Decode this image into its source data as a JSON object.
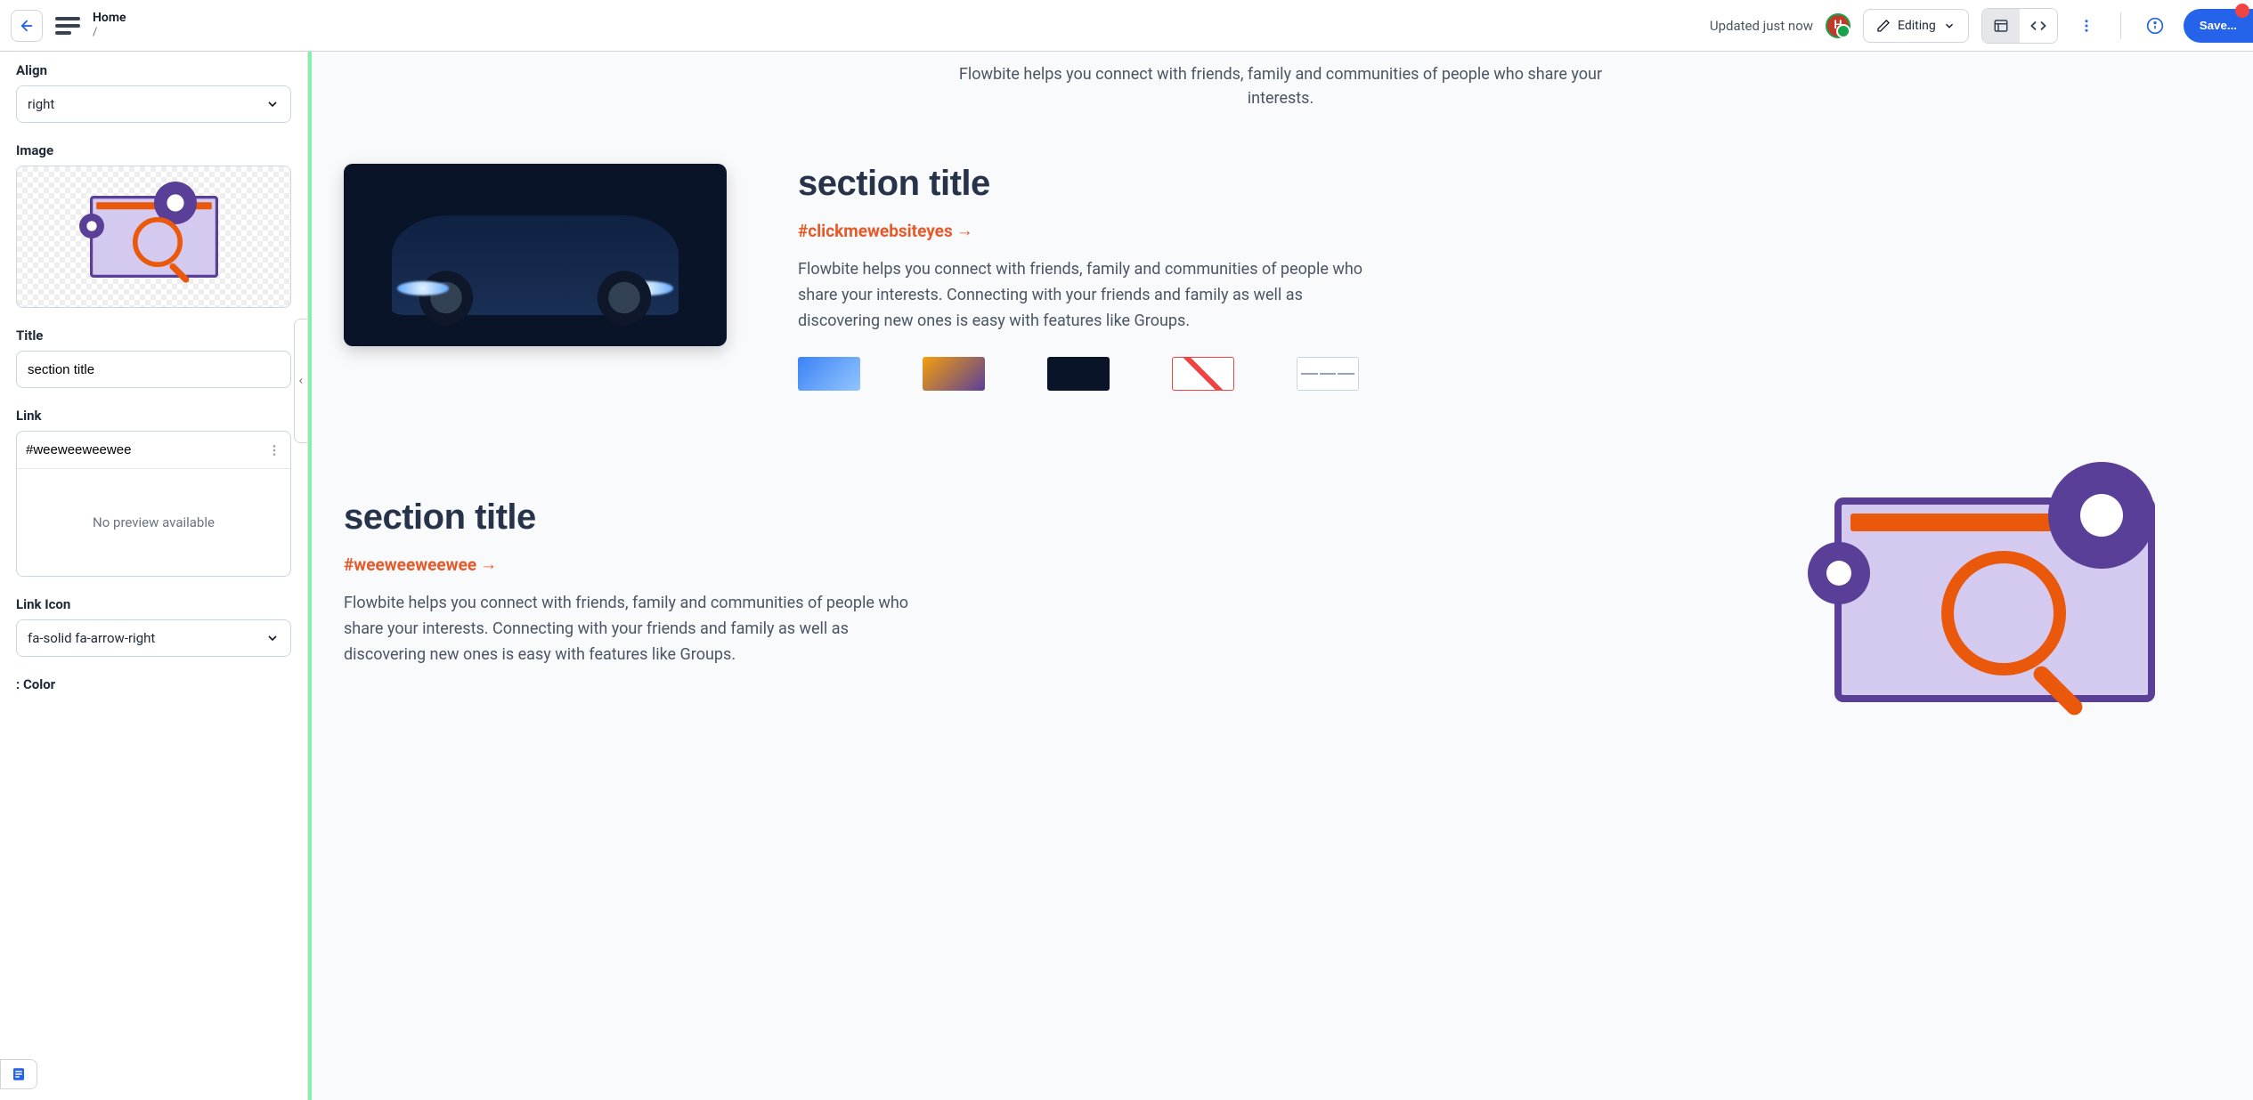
{
  "topbar": {
    "page_title": "Home",
    "breadcrumb": "/",
    "status": "Updated just now",
    "avatar_initial": "H",
    "mode_label": "Editing",
    "save_label": "Save..."
  },
  "sidebar": {
    "align": {
      "label": "Align",
      "value": "right"
    },
    "image": {
      "label": "Image"
    },
    "title": {
      "label": "Title",
      "value": "section title"
    },
    "link": {
      "label": "Link",
      "value": "#weeweeweewee",
      "preview_text": "No preview available"
    },
    "link_icon": {
      "label": "Link Icon",
      "value": "fa-solid fa-arrow-right"
    },
    "partial_next_label": ": Color"
  },
  "canvas": {
    "intro": "Flowbite helps you connect with friends, family and communities of people who share your interests.",
    "sections": [
      {
        "title": "section title",
        "link_text": "#clickmewebsiteyes",
        "link_arrow": "→",
        "desc": "Flowbite helps you connect with friends, family and communities of people who share your interests. Connecting with your friends and family as well as discovering new ones is easy with features like Groups."
      },
      {
        "title": "section title",
        "link_text": "#weeweeweewee",
        "link_arrow": "→",
        "desc": "Flowbite helps you connect with friends, family and communities of people who share your interests. Connecting with your friends and family as well as discovering new ones is easy with features like Groups."
      }
    ]
  }
}
